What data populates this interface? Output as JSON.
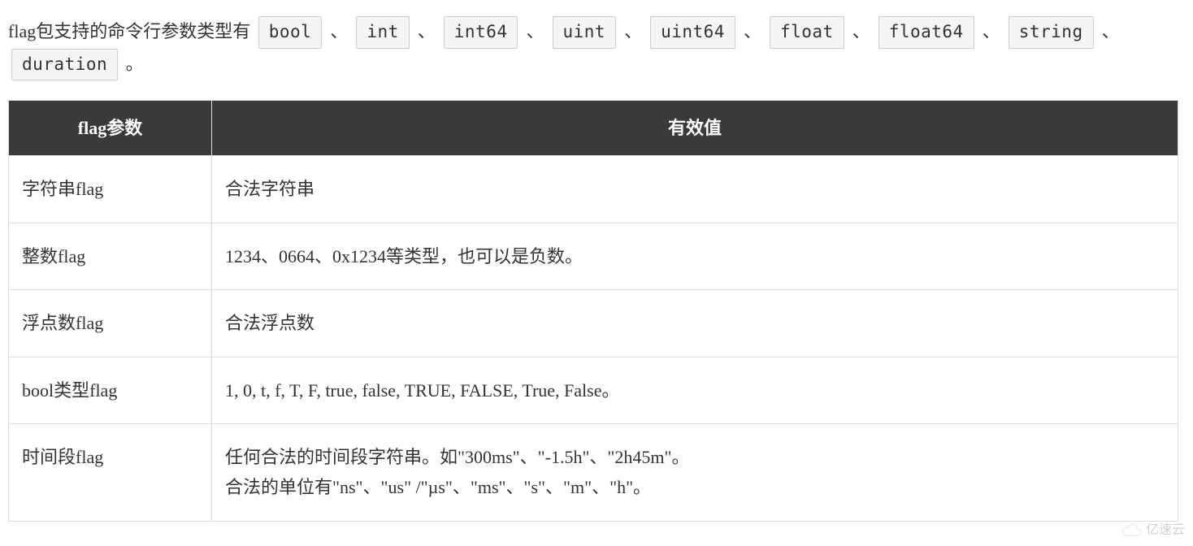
{
  "intro": {
    "prefix": "flag包支持的命令行参数类型有",
    "types": [
      "bool",
      "int",
      "int64",
      "uint",
      "uint64",
      "float",
      "float64",
      "string",
      "duration"
    ],
    "separator": "、",
    "suffix": "。"
  },
  "table": {
    "headers": [
      "flag参数",
      "有效值"
    ],
    "rows": [
      {
        "param": "字符串flag",
        "value": "合法字符串"
      },
      {
        "param": "整数flag",
        "value": "1234、0664、0x1234等类型，也可以是负数。"
      },
      {
        "param": "浮点数flag",
        "value": "合法浮点数"
      },
      {
        "param": "bool类型flag",
        "value": "1, 0, t, f, T, F, true, false, TRUE, FALSE, True, False。"
      },
      {
        "param": "时间段flag",
        "value": "任何合法的时间段字符串。如\"300ms\"、\"-1.5h\"、\"2h45m\"。\n合法的单位有\"ns\"、\"us\" /\"µs\"、\"ms\"、\"s\"、\"m\"、\"h\"。"
      }
    ]
  },
  "watermark": "亿速云"
}
